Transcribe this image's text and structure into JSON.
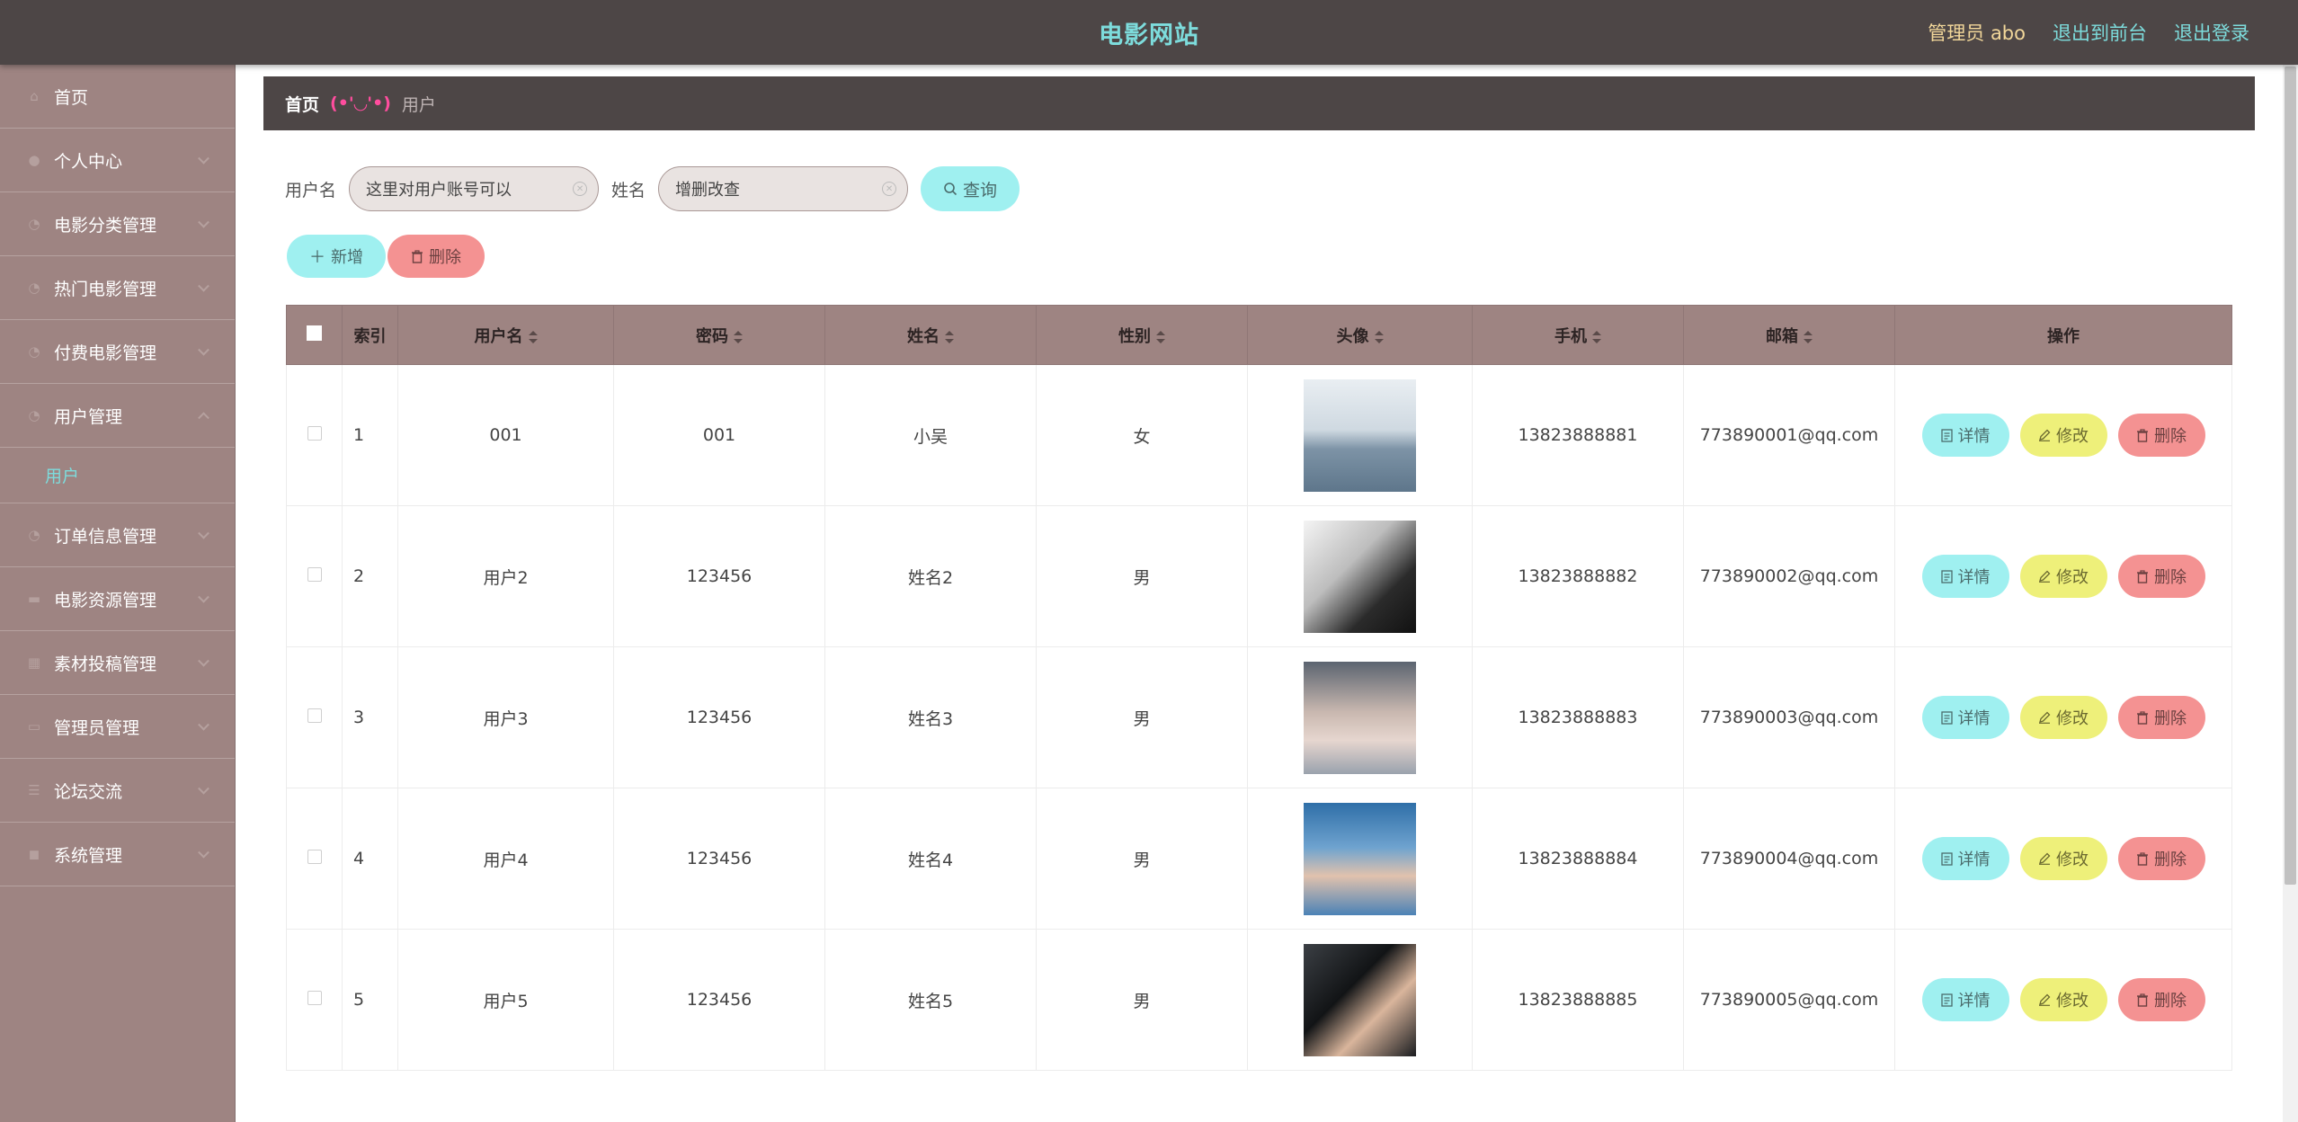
{
  "header": {
    "site_title": "电影网站",
    "admin_label": "管理员 abo",
    "to_front": "退出到前台",
    "logout": "退出登录"
  },
  "sidebar": {
    "items": [
      {
        "label": "首页",
        "icon": "home-icon"
      },
      {
        "label": "个人中心",
        "icon": "user-icon"
      },
      {
        "label": "电影分类管理",
        "icon": "list-icon"
      },
      {
        "label": "热门电影管理",
        "icon": "list-icon"
      },
      {
        "label": "付费电影管理",
        "icon": "list-icon"
      },
      {
        "label": "用户管理",
        "icon": "list-icon"
      },
      {
        "label": "用户",
        "sub": true
      },
      {
        "label": "订单信息管理",
        "icon": "list-icon"
      },
      {
        "label": "电影资源管理",
        "icon": "list-icon"
      },
      {
        "label": "素材投稿管理",
        "icon": "list-icon"
      },
      {
        "label": "管理员管理",
        "icon": "list-icon"
      },
      {
        "label": "论坛交流",
        "icon": "list-icon"
      },
      {
        "label": "系统管理",
        "icon": "list-icon"
      }
    ]
  },
  "breadcrumb": {
    "home": "首页",
    "separator": "(•'◡'•)",
    "current": "用户"
  },
  "search": {
    "username_label": "用户名",
    "username_value": "这里对用户账号可以",
    "name_label": "姓名",
    "name_value": "增删改查",
    "query_button": "查询"
  },
  "actions": {
    "add": "新增",
    "delete": "删除"
  },
  "table": {
    "columns": [
      "索引",
      "用户名",
      "密码",
      "姓名",
      "性别",
      "头像",
      "手机",
      "邮箱",
      "操作"
    ],
    "rows": [
      {
        "index": "1",
        "username": "001",
        "password": "001",
        "name": "小吴",
        "gender": "女",
        "phone": "13823888881",
        "email": "773890001@qq.com"
      },
      {
        "index": "2",
        "username": "用户2",
        "password": "123456",
        "name": "姓名2",
        "gender": "男",
        "phone": "13823888882",
        "email": "773890002@qq.com"
      },
      {
        "index": "3",
        "username": "用户3",
        "password": "123456",
        "name": "姓名3",
        "gender": "男",
        "phone": "13823888883",
        "email": "773890003@qq.com"
      },
      {
        "index": "4",
        "username": "用户4",
        "password": "123456",
        "name": "姓名4",
        "gender": "男",
        "phone": "13823888884",
        "email": "773890004@qq.com"
      },
      {
        "index": "5",
        "username": "用户5",
        "password": "123456",
        "name": "姓名5",
        "gender": "男",
        "phone": "13823888885",
        "email": "773890005@qq.com"
      }
    ],
    "op_detail": "详情",
    "op_edit": "修改",
    "op_delete": "删除"
  },
  "colors": {
    "header_bg": "#4d4646",
    "sidebar_bg": "#9e8482",
    "accent_cyan": "#9ff0f0",
    "accent_yellow": "#eef07a",
    "accent_red": "#f49292"
  }
}
